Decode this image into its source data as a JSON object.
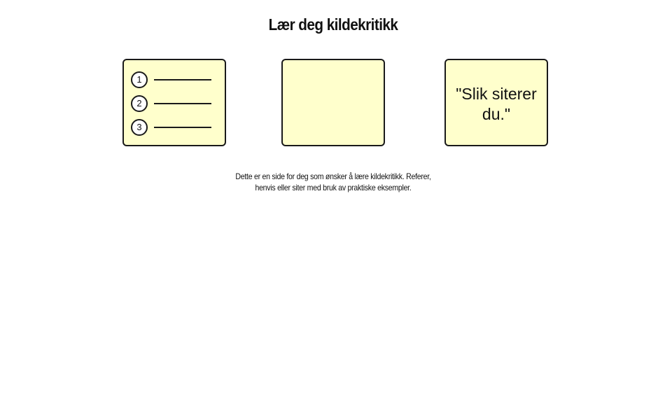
{
  "page": {
    "title": "Lær deg kildekritikk",
    "description_line1": "Dette er en side for deg som ønsker å lære kildekritikk. Referer,",
    "description_line2": "henvis eller siter med bruk av praktiske eksempler."
  },
  "cards": {
    "list": {
      "icon": "numbered-list-icon",
      "items": [
        "1",
        "2",
        "3"
      ]
    },
    "blank": {
      "icon": "blank-card"
    },
    "quote": {
      "line1": "\"Slik siterer",
      "line2": "du.\""
    }
  },
  "colors": {
    "card_background": "#ffffcc",
    "card_border": "#1a1a1a",
    "page_background": "#ffffff"
  }
}
